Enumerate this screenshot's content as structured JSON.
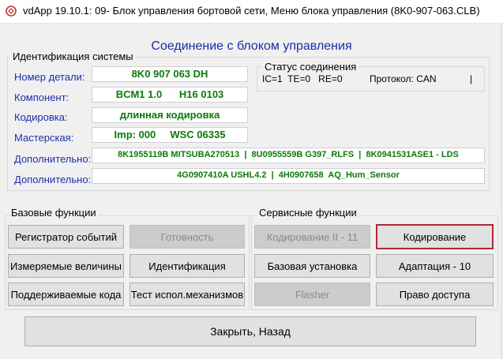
{
  "window": {
    "title": "vdApp 19.10.1: 09- Блок управления бортовой сети,  Меню блока управления (8K0-907-063.CLB)"
  },
  "heading": "Соединение с блоком управления",
  "identification": {
    "group_title": "Идентификация системы",
    "part_number_label": "Номер детали:",
    "part_number": "8K0 907 063 DH",
    "component_label": "Компонент:",
    "component": "BCM1 1.0      H16 0103",
    "coding_label": "Кодировка:",
    "coding": "длинная кодировка",
    "workshop_label": "Мастерская:",
    "workshop": "Imp: 000     WSC 06335",
    "additional_label_1": "Дополнительно:",
    "additional_1": "8K1955119B MITSUBA270513  |  8U0955559B G397_RLFS  |  8K0941531ASE1 - LDS",
    "additional_label_2": "Дополнительно:",
    "additional_2": "4G0907410A USHL4.2  |  4H0907658  AQ_Hum_Sensor"
  },
  "connection_status": {
    "group_title": "Статус соединения",
    "counters": "IC=1  TE=0   RE=0",
    "protocol": "Протокол: CAN",
    "indicator": "|"
  },
  "basic_functions": {
    "group_title": "Базовые функции",
    "event_recorder": "Регистратор событий",
    "readiness": "Готовность",
    "measured_values": "Измеряемые величины",
    "identification": "Идентификация",
    "supported_codes": "Поддерживаемые кода",
    "actuator_test": "Тест испол.механизмов"
  },
  "service_functions": {
    "group_title": "Сервисные функции",
    "coding_11": "Кодирование II - 11",
    "coding": "Кодирование",
    "basic_setting": "Базовая установка",
    "adaptation_10": "Адаптация - 10",
    "flasher": "Flasher",
    "access_rights": "Право доступа"
  },
  "close_button": "Закрыть, Назад"
}
